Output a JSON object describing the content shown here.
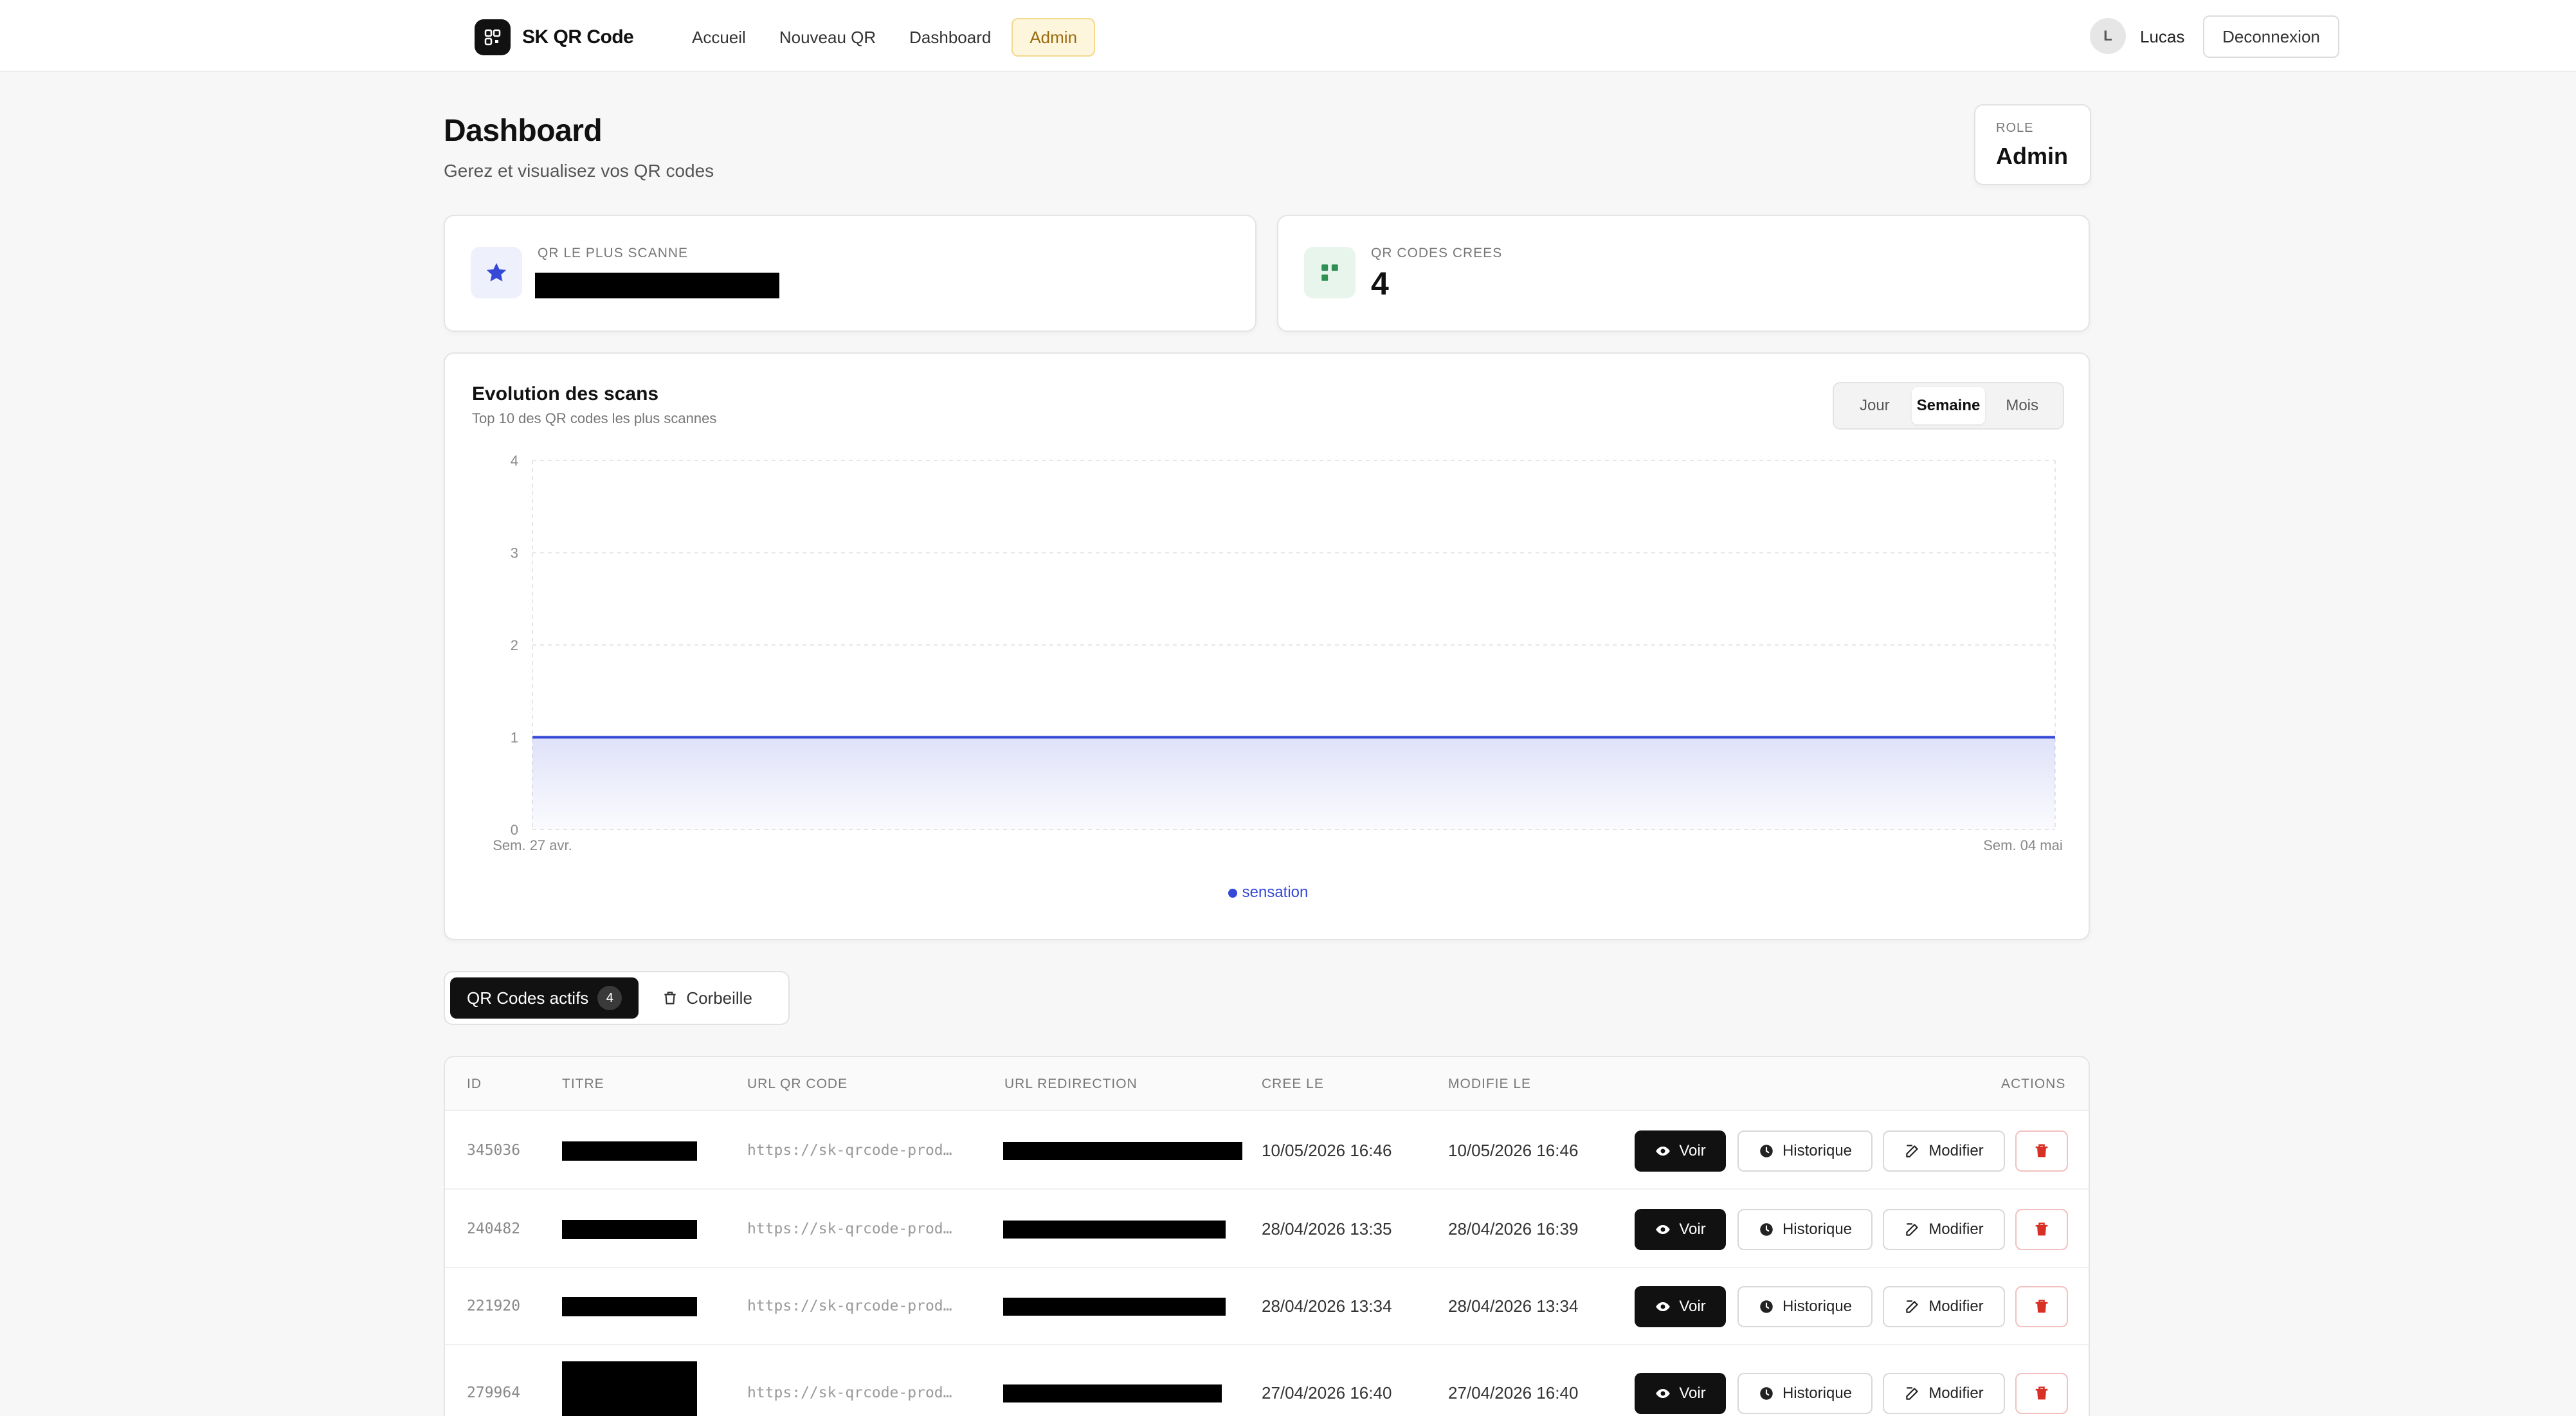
{
  "nav": {
    "brand": "SK QR Code",
    "links": [
      "Accueil",
      "Nouveau QR",
      "Dashboard",
      "Admin"
    ],
    "active_link": "Admin",
    "user_initial": "L",
    "user_name": "Lucas",
    "logout_label": "Deconnexion"
  },
  "header": {
    "title": "Dashboard",
    "subtitle": "Gerez et visualisez vos QR codes",
    "role_label": "ROLE",
    "role_value": "Admin"
  },
  "stats": {
    "most_scanned_label": "QR LE PLUS SCANNE",
    "created_label": "QR CODES CREES",
    "created_value": "4"
  },
  "chart": {
    "title": "Evolution des scans",
    "subtitle": "Top 10 des QR codes les plus scannes",
    "periods": [
      "Jour",
      "Semaine",
      "Mois"
    ],
    "active_period": "Semaine"
  },
  "chart_data": {
    "type": "area",
    "x": [
      "Sem. 27 avr.",
      "Sem. 04 mai"
    ],
    "series": [
      {
        "name": "sensation",
        "values": [
          1,
          1
        ],
        "color": "#3548d6"
      }
    ],
    "ylim": [
      0,
      4
    ],
    "yticks": [
      0,
      1,
      2,
      3,
      4
    ],
    "grid": true,
    "legend": "bottom-center"
  },
  "tabs": {
    "active_label": "QR Codes actifs",
    "active_count": "4",
    "trash_label": "Corbeille"
  },
  "table": {
    "headers": [
      "ID",
      "TITRE",
      "URL QR CODE",
      "URL REDIRECTION",
      "CREE LE",
      "MODIFIE LE",
      "ACTIONS"
    ],
    "rows": [
      {
        "id": "345036",
        "qr_url": "https://sk-qrcode-prod…",
        "created": "10/05/2026 16:46",
        "modified": "10/05/2026 16:46"
      },
      {
        "id": "240482",
        "qr_url": "https://sk-qrcode-prod…",
        "created": "28/04/2026 13:35",
        "modified": "28/04/2026 16:39"
      },
      {
        "id": "221920",
        "qr_url": "https://sk-qrcode-prod…",
        "created": "28/04/2026 13:34",
        "modified": "28/04/2026 13:34"
      },
      {
        "id": "279964",
        "qr_url": "https://sk-qrcode-prod…",
        "created": "27/04/2026 16:40",
        "modified": "27/04/2026 16:40"
      }
    ],
    "actions": {
      "view": "Voir",
      "history": "Historique",
      "edit": "Modifier"
    }
  },
  "colors": {
    "accent": "#3548d6",
    "admin_bg": "#fef6dc",
    "admin_text": "#9a6a0c",
    "danger": "#d93025"
  }
}
